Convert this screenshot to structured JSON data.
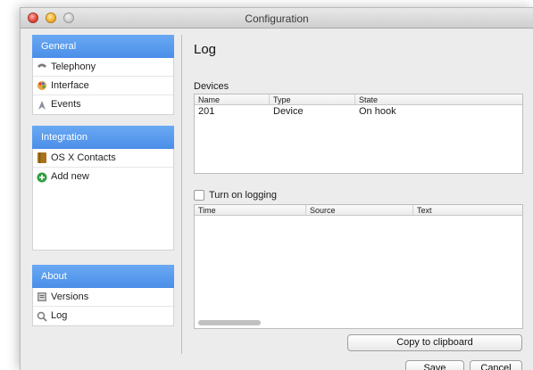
{
  "window": {
    "title": "Configuration"
  },
  "sidebar": {
    "sections": [
      {
        "header": "General",
        "items": [
          {
            "label": "Telephony",
            "icon": "phone-icon"
          },
          {
            "label": "Interface",
            "icon": "palette-icon"
          },
          {
            "label": "Events",
            "icon": "events-icon"
          }
        ]
      },
      {
        "header": "Integration",
        "items": [
          {
            "label": "OS X Contacts",
            "icon": "contacts-book-icon"
          },
          {
            "label": "Add new",
            "icon": "add-icon"
          }
        ]
      },
      {
        "header": "About",
        "items": [
          {
            "label": "Versions",
            "icon": "versions-icon"
          },
          {
            "label": "Log",
            "icon": "log-icon"
          }
        ]
      }
    ]
  },
  "main": {
    "title": "Log",
    "devices": {
      "label": "Devices",
      "columns": [
        "Name",
        "Type",
        "State"
      ],
      "rows": [
        [
          "201",
          "Device",
          "On hook"
        ]
      ]
    },
    "logging_checkbox": {
      "label": "Turn on logging",
      "checked": false
    },
    "log_table": {
      "columns": [
        "Time",
        "Source",
        "Text"
      ]
    },
    "copy_button": "Copy to clipboard",
    "save_button": "Save",
    "cancel_button": "Cancel"
  },
  "colors": {
    "accent": "#4a8ee8",
    "add_green": "#2f9e3e"
  }
}
